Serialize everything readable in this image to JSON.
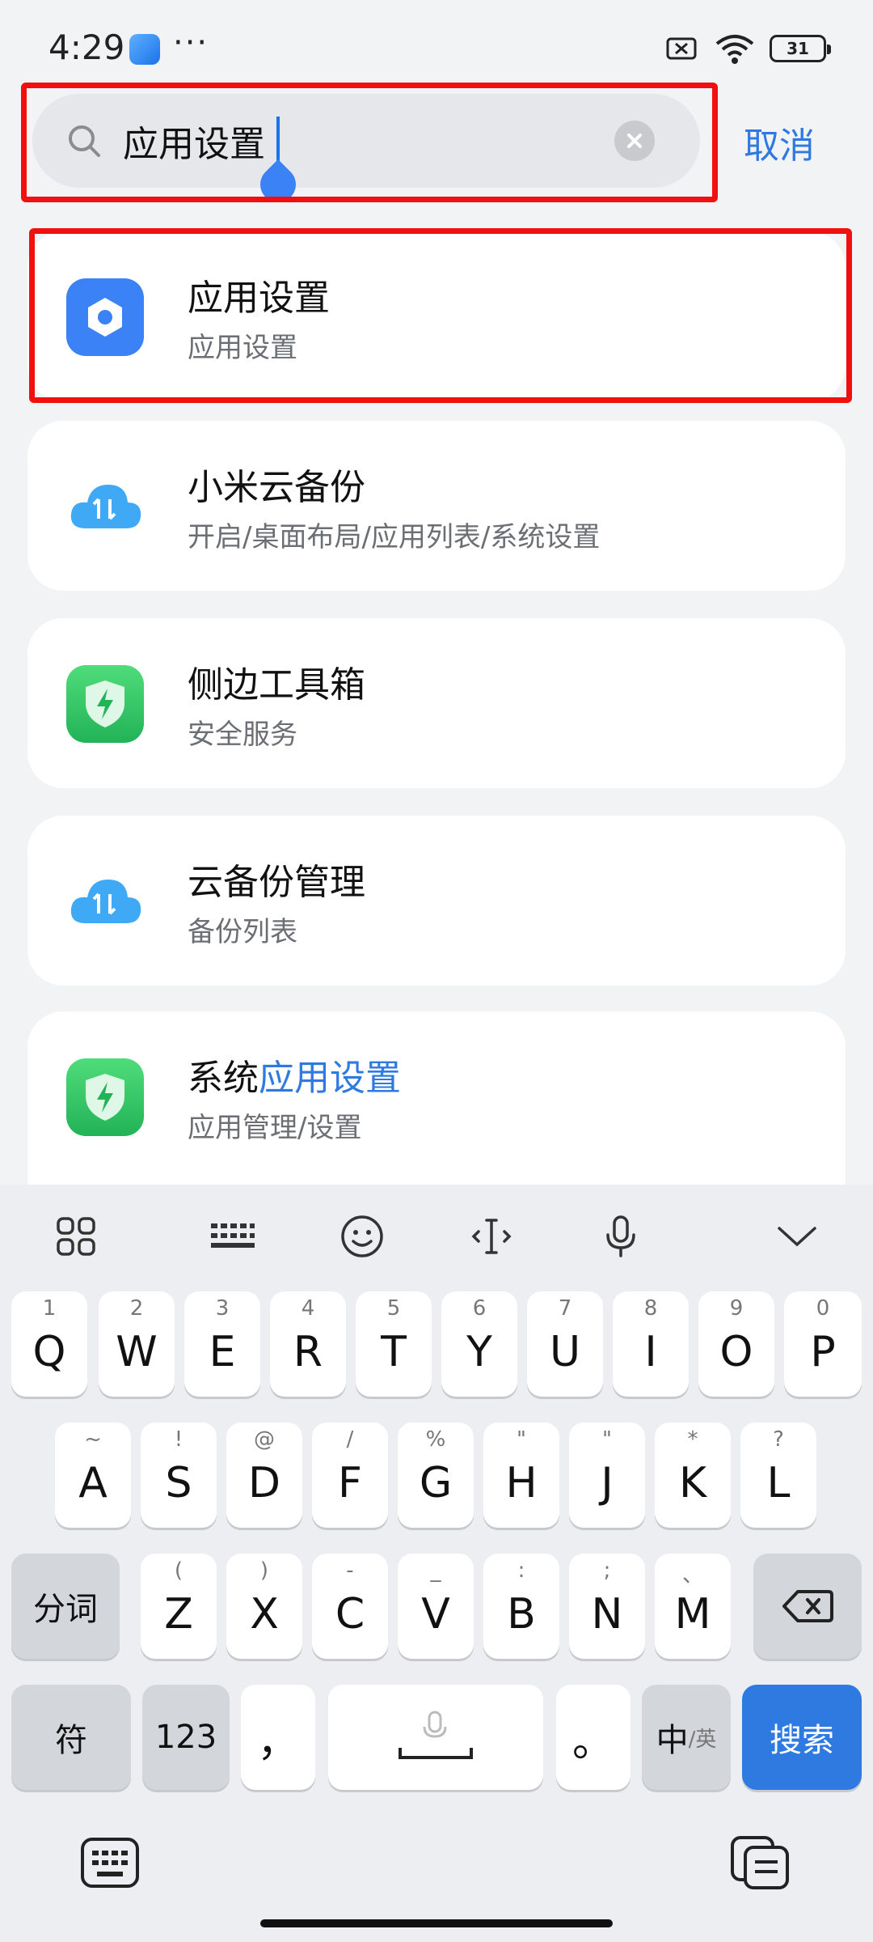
{
  "status": {
    "time": "4:29",
    "dots": "···",
    "battery": "31"
  },
  "search": {
    "value": "应用设置",
    "cancel": "取消"
  },
  "results": [
    {
      "title_plain": "",
      "title_hl": "应用设置",
      "subtitle": "应用设置",
      "icon": "settings-gear-icon"
    },
    {
      "title_plain": "小米云备份",
      "title_hl": "",
      "subtitle": "开启/桌面布局/应用列表/系统设置",
      "icon": "cloud-icon"
    },
    {
      "title_plain": "侧边工具箱",
      "title_hl": "",
      "subtitle": "安全服务",
      "icon": "shield-icon"
    },
    {
      "title_plain": "云备份管理",
      "title_hl": "",
      "subtitle": "备份列表",
      "icon": "cloud-icon"
    },
    {
      "title_plain": "系统",
      "title_hl": "应用设置",
      "subtitle": "应用管理/设置",
      "icon": "shield-icon"
    }
  ],
  "keyboard": {
    "row1": [
      {
        "k": "Q",
        "h": "1"
      },
      {
        "k": "W",
        "h": "2"
      },
      {
        "k": "E",
        "h": "3"
      },
      {
        "k": "R",
        "h": "4"
      },
      {
        "k": "T",
        "h": "5"
      },
      {
        "k": "Y",
        "h": "6"
      },
      {
        "k": "U",
        "h": "7"
      },
      {
        "k": "I",
        "h": "8"
      },
      {
        "k": "O",
        "h": "9"
      },
      {
        "k": "P",
        "h": "0"
      }
    ],
    "row2": [
      {
        "k": "A",
        "h": "~"
      },
      {
        "k": "S",
        "h": "!"
      },
      {
        "k": "D",
        "h": "@"
      },
      {
        "k": "F",
        "h": "/"
      },
      {
        "k": "G",
        "h": "%"
      },
      {
        "k": "H",
        "h": "\""
      },
      {
        "k": "J",
        "h": "\""
      },
      {
        "k": "K",
        "h": "*"
      },
      {
        "k": "L",
        "h": "?"
      }
    ],
    "row3": [
      {
        "k": "Z",
        "h": "("
      },
      {
        "k": "X",
        "h": ")"
      },
      {
        "k": "C",
        "h": "-"
      },
      {
        "k": "V",
        "h": "_"
      },
      {
        "k": "B",
        "h": ":"
      },
      {
        "k": "N",
        "h": ";"
      },
      {
        "k": "M",
        "h": "、"
      }
    ],
    "fenci": "分词",
    "fu": "符",
    "num": "123",
    "comma": "，",
    "period": "。",
    "lang_main": "中",
    "lang_sub": "/英",
    "search": "搜索"
  },
  "colors": {
    "accent": "#2f7ae0",
    "highlight_box": "#f01010"
  }
}
